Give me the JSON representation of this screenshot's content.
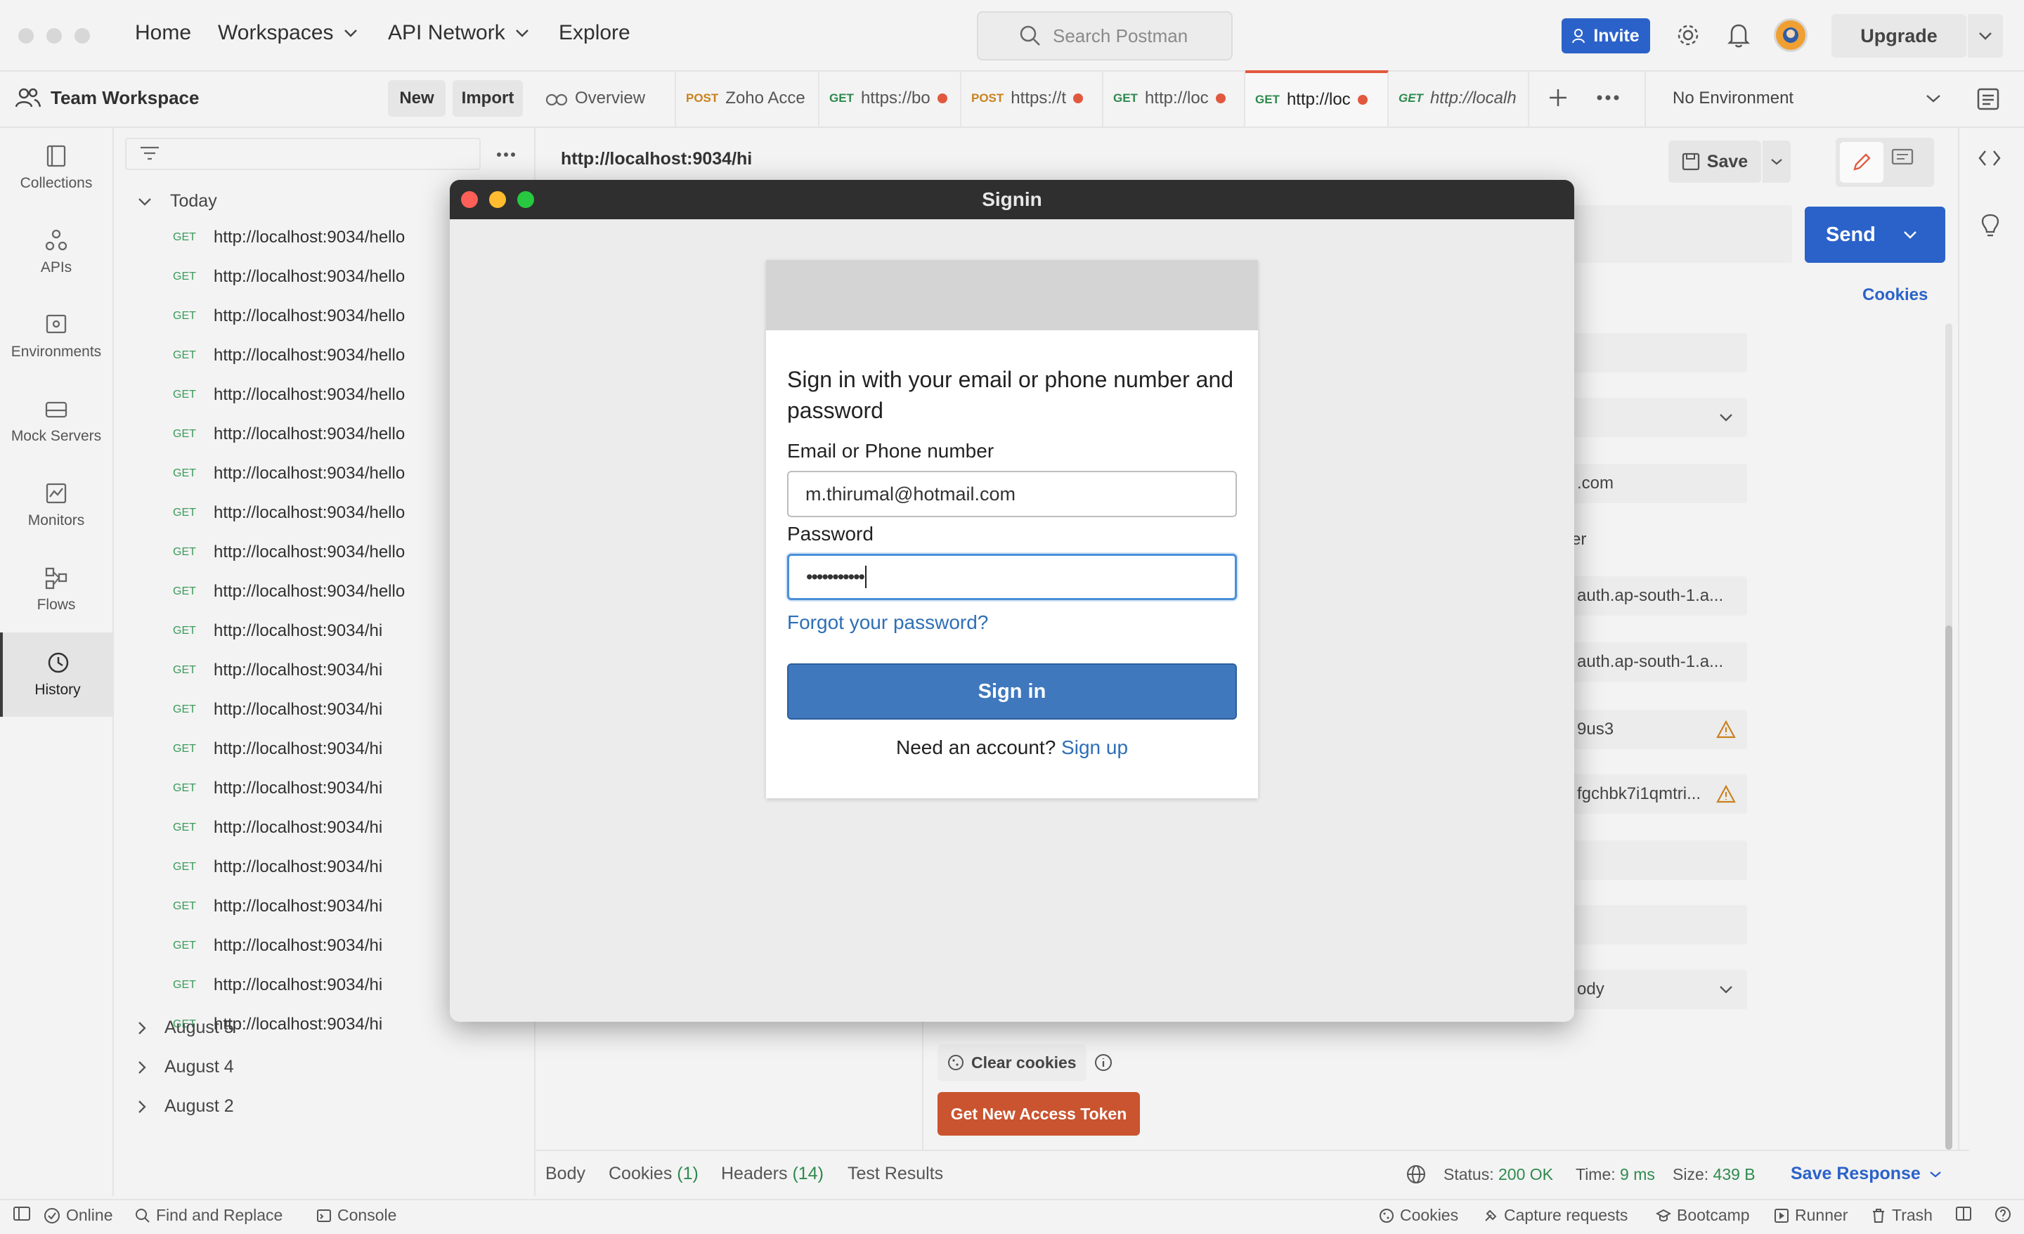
{
  "topbar": {
    "nav": [
      "Home",
      "Workspaces",
      "API Network",
      "Explore"
    ],
    "search_placeholder": "Search Postman",
    "invite": "Invite",
    "upgrade": "Upgrade"
  },
  "workspace": {
    "name": "Team Workspace",
    "new": "New",
    "import": "Import"
  },
  "tabs": [
    {
      "label": "Overview"
    },
    {
      "method": "POST",
      "label": "Zoho Acce"
    },
    {
      "method": "GET",
      "label": "https://bo"
    },
    {
      "method": "POST",
      "label": "https://t"
    },
    {
      "method": "GET",
      "label": "http://loc"
    },
    {
      "method": "GET",
      "label": "http://loc"
    },
    {
      "method": "GET",
      "label": "http://localh"
    }
  ],
  "environment": "No Environment",
  "rail": [
    "Collections",
    "APIs",
    "Environments",
    "Mock Servers",
    "Monitors",
    "Flows",
    "History"
  ],
  "history": {
    "today_label": "Today",
    "method": "GET",
    "hello_url": "http://localhost:9034/hello",
    "hi_url": "http://localhost:9034/hi",
    "groups": [
      "August 5",
      "August 4",
      "August 2"
    ]
  },
  "editor": {
    "url_title": "http://localhost:9034/hi",
    "save": "Save",
    "send": "Send",
    "cookies": "Cookies",
    "fragments": [
      ".com",
      "er",
      "auth.ap-south-1.a...",
      "auth.ap-south-1.a...",
      "9us3",
      "fgchbk7i1qmtri...",
      "ody"
    ],
    "clear_cookies": "Clear cookies",
    "get_new_token": "Get New Access Token"
  },
  "response": {
    "tabs": [
      "Body",
      "Cookies",
      "(1)",
      "Headers",
      "(14)",
      "Test Results"
    ],
    "status_label": "Status:",
    "status_value": "200 OK",
    "time_label": "Time:",
    "time_value": "9 ms",
    "size_label": "Size:",
    "size_value": "439 B",
    "save_response": "Save Response"
  },
  "statusbar": {
    "online": "Online",
    "find": "Find and Replace",
    "console": "Console",
    "cookies": "Cookies",
    "capture": "Capture requests",
    "bootcamp": "Bootcamp",
    "runner": "Runner",
    "trash": "Trash"
  },
  "dialog": {
    "window_title": "Signin",
    "heading_line1": "Sign in with your email or phone number and",
    "heading_line2": "password",
    "email_label": "Email or Phone number",
    "email_value": "m.thirumal@hotmail.com",
    "password_label": "Password",
    "password_value": "•••••••••••",
    "forgot": "Forgot your password?",
    "signin_button": "Sign in",
    "need_account": "Need an account?",
    "signup": "Sign up"
  },
  "colors": {
    "accent": "#e2583e",
    "primary_blue": "#2b62c9",
    "signin_blue": "#3f78bd",
    "get_green": "#2e8a4e",
    "post_orange": "#c9821e"
  }
}
